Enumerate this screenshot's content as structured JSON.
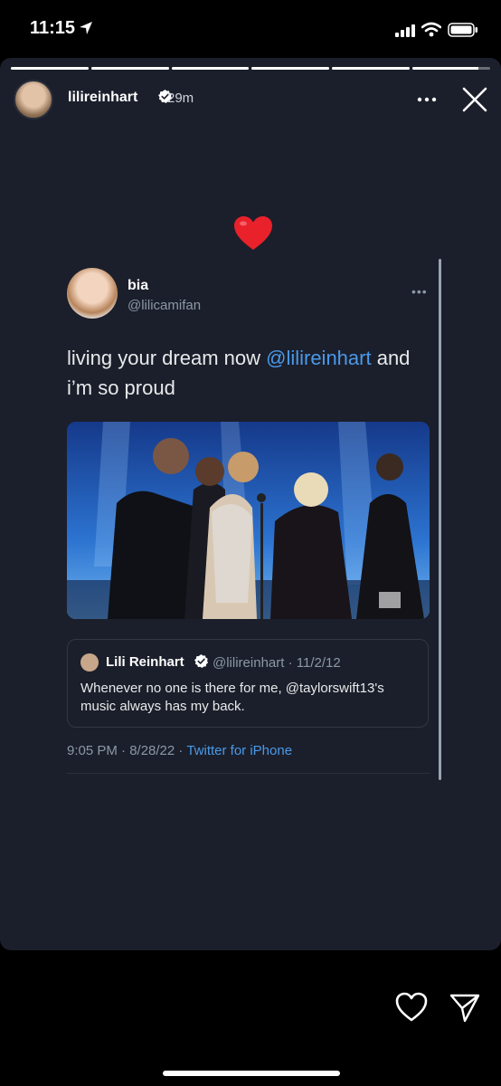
{
  "status_bar": {
    "time": "11:15",
    "icons": [
      "location-arrow-icon",
      "cellular-signal-icon",
      "wifi-icon",
      "battery-icon"
    ]
  },
  "story": {
    "progress": {
      "segments": 6,
      "completed": 5,
      "current_fraction": 0.85
    },
    "user": {
      "username": "lilireinhart",
      "verified": true,
      "time_ago": "29m"
    },
    "controls": [
      "more-icon",
      "close-icon"
    ],
    "sticker": "red-heart"
  },
  "tweet": {
    "display_name": "bia",
    "handle": "@lilicamifan",
    "text_before": "living your dream now ",
    "mention": "@lilireinhart",
    "text_after": " and i’m so proud",
    "photo_alt": "",
    "quote": {
      "display_name": "Lili Reinhart",
      "handle_and_date": "@lilireinhart · 11/2/12",
      "text": "Whenever no one is there for me, @taylorswift13's music always has my back."
    },
    "timestamp": "9:05 PM · 8/28/22 · ",
    "source": "Twitter for iPhone"
  },
  "footer": {
    "actions": [
      "like-icon",
      "share-icon"
    ]
  },
  "colors": {
    "background": "#000000",
    "card": "#1b1f2b",
    "link": "#4a99e9",
    "secondary_text": "#8b98a5",
    "heart": "#e8212b"
  }
}
